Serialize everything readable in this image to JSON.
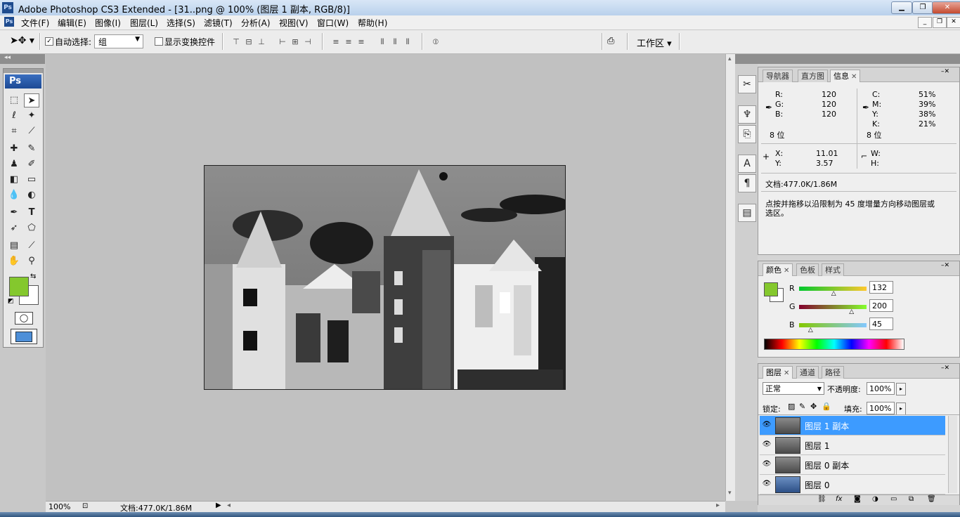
{
  "window": {
    "title": "Adobe Photoshop CS3 Extended - [31..png @ 100% (图层 1 副本, RGB/8)]",
    "app_badge": "Ps",
    "minimize": "▁",
    "restore": "❐",
    "close": "✕"
  },
  "menubar": {
    "items": [
      "文件(F)",
      "编辑(E)",
      "图像(I)",
      "图层(L)",
      "选择(S)",
      "滤镜(T)",
      "分析(A)",
      "视图(V)",
      "窗口(W)",
      "帮助(H)"
    ],
    "doc_min": "_",
    "doc_restore": "❐",
    "doc_close": "✕"
  },
  "options": {
    "auto_select_label": "自动选择:",
    "auto_select_checked": "✓",
    "auto_select_value": "组",
    "show_transform_label": "显示变换控件",
    "workspace_label": "工作区 ▾"
  },
  "toolbox": {
    "badge": "Ps"
  },
  "colors": {
    "foreground": "#84c82d",
    "background": "#ffffff",
    "selection_blue": "#3d9bff"
  },
  "status": {
    "zoom": "100%",
    "doc_info": "文档:477.0K/1.86M"
  },
  "info_panel": {
    "tabs": [
      "导航器",
      "直方图",
      "信息"
    ],
    "rgb": [
      {
        "label": "R:",
        "value": "120"
      },
      {
        "label": "G:",
        "value": "120"
      },
      {
        "label": "B:",
        "value": "120"
      }
    ],
    "cmyk": [
      {
        "label": "C:",
        "value": "51%"
      },
      {
        "label": "M:",
        "value": "39%"
      },
      {
        "label": "Y:",
        "value": "38%"
      },
      {
        "label": "K:",
        "value": "21%"
      }
    ],
    "bits_left": "8 位",
    "bits_right": "8 位",
    "xy": [
      {
        "label": "X:",
        "value": "11.01"
      },
      {
        "label": "Y:",
        "value": "3.57"
      }
    ],
    "wh": [
      {
        "label": "W:",
        "value": ""
      },
      {
        "label": "H:",
        "value": ""
      }
    ],
    "doc_info": "文档:477.0K/1.86M",
    "hint_line1": "点按并拖移以沿限制为 45 度增量方向移动图层或",
    "hint_line2": "选区。"
  },
  "color_panel": {
    "tabs": [
      "颜色",
      "色板",
      "样式"
    ],
    "channels": [
      {
        "label": "R",
        "value": "132",
        "fraction": 0.518
      },
      {
        "label": "G",
        "value": "200",
        "fraction": 0.784
      },
      {
        "label": "B",
        "value": "45",
        "fraction": 0.176
      }
    ]
  },
  "layers_panel": {
    "tabs": [
      "图层",
      "通道",
      "路径"
    ],
    "blend_mode": "正常",
    "opacity_label": "不透明度:",
    "opacity_value": "100%",
    "lock_label": "锁定:",
    "fill_label": "填充:",
    "fill_value": "100%",
    "layers": [
      {
        "name": "图层 1 副本",
        "selected": true
      },
      {
        "name": "图层 1",
        "selected": false
      },
      {
        "name": "图层 0 副本",
        "selected": false
      },
      {
        "name": "图层 0",
        "selected": false
      }
    ]
  }
}
